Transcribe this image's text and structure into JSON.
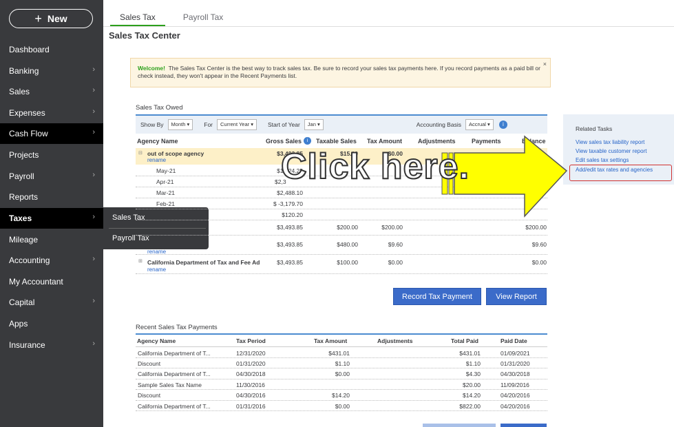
{
  "sidebar": {
    "new_label": "New",
    "items": [
      {
        "label": "Dashboard"
      },
      {
        "label": "Banking"
      },
      {
        "label": "Sales"
      },
      {
        "label": "Expenses"
      },
      {
        "label": "Cash Flow"
      },
      {
        "label": "Projects"
      },
      {
        "label": "Payroll"
      },
      {
        "label": "Reports"
      },
      {
        "label": "Taxes"
      },
      {
        "label": "Mileage"
      },
      {
        "label": "Accounting"
      },
      {
        "label": "My Accountant"
      },
      {
        "label": "Capital"
      },
      {
        "label": "Apps"
      },
      {
        "label": "Insurance"
      }
    ],
    "flyout": [
      "Sales Tax",
      "Payroll Tax"
    ]
  },
  "tabs": [
    "Sales Tax",
    "Payroll Tax"
  ],
  "page_title": "Sales Tax Center",
  "welcome": {
    "bold": "Welcome!",
    "text": "The Sales Tax Center is the best way to track sales tax. Be sure to record your sales tax payments here. If you record payments as a paid bill or check instead, they won't appear in the Recent Payments list.",
    "close": "×"
  },
  "owed": {
    "title": "Sales Tax Owed",
    "show_by_label": "Show By",
    "show_by": "Month",
    "for_label": "For",
    "for": "Current Year",
    "start_label": "Start of Year",
    "start": "Jan",
    "basis_label": "Accounting Basis",
    "basis": "Accrual",
    "columns": [
      "Agency Name",
      "Gross Sales",
      "Taxable Sales",
      "Tax Amount",
      "Adjustments",
      "Payments",
      "Balance"
    ],
    "rows": [
      {
        "name": "out of scope agency",
        "gross": "$3,493.85",
        "taxable": "$15.00",
        "tax": "$0.00",
        "balance": "",
        "rename": "rename"
      },
      {
        "name": "May-21",
        "gross": "$1,0?4.25",
        "taxable": "",
        "tax": "",
        "balance": ""
      },
      {
        "name": "Apr-21",
        "gross": "$2,3",
        "taxable": "",
        "tax": "",
        "balance": ""
      },
      {
        "name": "Mar-21",
        "gross": "$2,488.10",
        "taxable": "",
        "tax": "",
        "balance": ""
      },
      {
        "name": "Feb-21",
        "gross": "$ -3,179.70",
        "taxable": "",
        "tax": "",
        "balance": ""
      },
      {
        "name": "",
        "gross": "$120.20",
        "taxable": "",
        "tax": "",
        "balance": ""
      },
      {
        "name": "",
        "gross": "$3,493.85",
        "taxable": "$200.00",
        "tax": "$200.00",
        "balance": "$200.00"
      },
      {
        "name": "",
        "gross": "$3,493.85",
        "taxable": "$480.00",
        "tax": "$9.60",
        "balance": "$9.60",
        "rename": "rename"
      },
      {
        "name": "California Department of Tax and Fee Ad",
        "gross": "$3,493.85",
        "taxable": "$100.00",
        "tax": "$0.00",
        "balance": "$0.00",
        "rename": "rename"
      }
    ]
  },
  "buttons": {
    "record": "Record Tax Payment",
    "view_report": "View Report"
  },
  "payments": {
    "title": "Recent Sales Tax Payments",
    "columns": [
      "Agency Name",
      "Tax Period",
      "Tax Amount",
      "Adjustments",
      "Total Paid",
      "Paid Date"
    ],
    "rows": [
      [
        "California Department of T...",
        "12/31/2020",
        "$431.01",
        "",
        "$431.01",
        "01/09/2021"
      ],
      [
        "Discount",
        "01/31/2020",
        "$1.10",
        "",
        "$1.10",
        "01/31/2020"
      ],
      [
        "California Department of T...",
        "04/30/2018",
        "$0.00",
        "",
        "$4.30",
        "04/30/2018"
      ],
      [
        "Sample Sales Tax Name",
        "11/30/2016",
        "",
        "",
        "$20.00",
        "11/09/2016"
      ],
      [
        "Discount",
        "04/30/2016",
        "$14.20",
        "",
        "$14.20",
        "04/20/2016"
      ],
      [
        "California Department of T...",
        "01/31/2016",
        "$0.00",
        "",
        "$822.00",
        "04/20/2016"
      ]
    ]
  },
  "related": {
    "title": "Related Tasks",
    "links": [
      "View sales tax liability report",
      "View taxable customer report",
      "Edit sales tax settings",
      "Add/edit tax rates and agencies"
    ]
  },
  "overlay": {
    "text": "Click here.",
    "arrow_color": "#ffff00"
  }
}
